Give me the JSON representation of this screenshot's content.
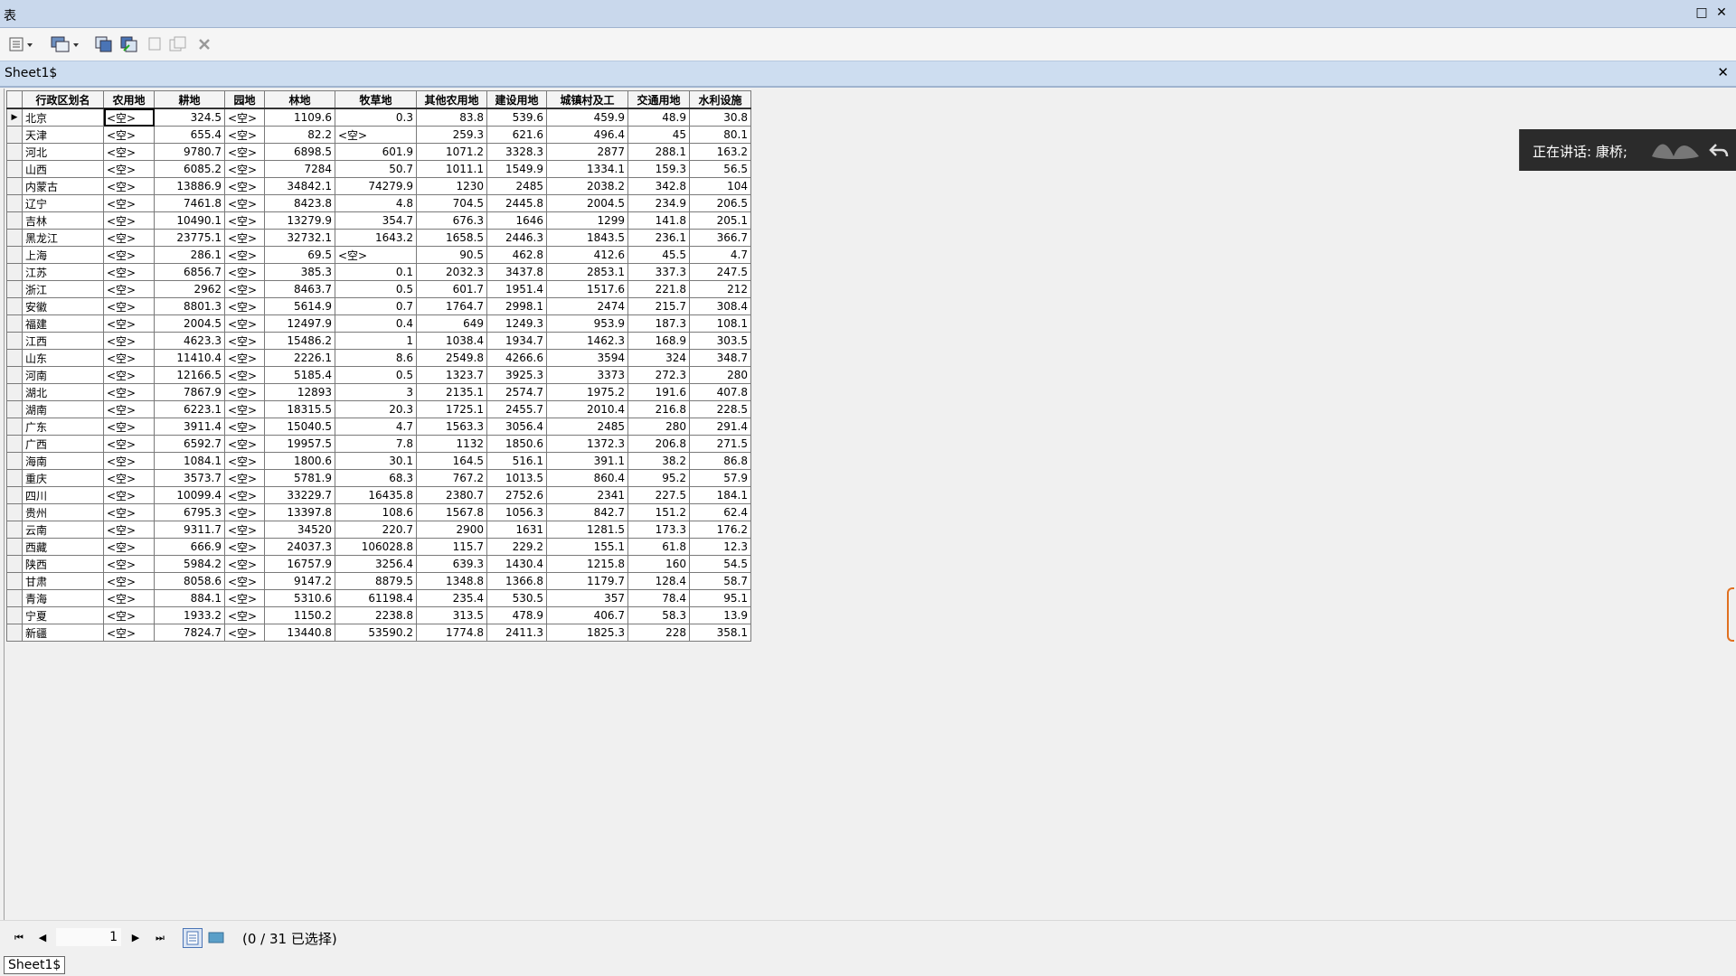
{
  "window": {
    "title": "表"
  },
  "tab": {
    "title": "Sheet1$"
  },
  "table": {
    "headers": [
      "行政区划名",
      "农用地",
      "耕地",
      "园地",
      "林地",
      "牧草地",
      "其他农用地",
      "建设用地",
      "城镇村及工",
      "交通用地",
      "水利设施"
    ],
    "rows": [
      [
        "北京",
        "<空>",
        "324.5",
        "<空>",
        "1109.6",
        "0.3",
        "83.8",
        "539.6",
        "459.9",
        "48.9",
        "30.8"
      ],
      [
        "天津",
        "<空>",
        "655.4",
        "<空>",
        "82.2",
        "<空>",
        "259.3",
        "621.6",
        "496.4",
        "45",
        "80.1"
      ],
      [
        "河北",
        "<空>",
        "9780.7",
        "<空>",
        "6898.5",
        "601.9",
        "1071.2",
        "3328.3",
        "2877",
        "288.1",
        "163.2"
      ],
      [
        "山西",
        "<空>",
        "6085.2",
        "<空>",
        "7284",
        "50.7",
        "1011.1",
        "1549.9",
        "1334.1",
        "159.3",
        "56.5"
      ],
      [
        "内蒙古",
        "<空>",
        "13886.9",
        "<空>",
        "34842.1",
        "74279.9",
        "1230",
        "2485",
        "2038.2",
        "342.8",
        "104"
      ],
      [
        "辽宁",
        "<空>",
        "7461.8",
        "<空>",
        "8423.8",
        "4.8",
        "704.5",
        "2445.8",
        "2004.5",
        "234.9",
        "206.5"
      ],
      [
        "吉林",
        "<空>",
        "10490.1",
        "<空>",
        "13279.9",
        "354.7",
        "676.3",
        "1646",
        "1299",
        "141.8",
        "205.1"
      ],
      [
        "黑龙江",
        "<空>",
        "23775.1",
        "<空>",
        "32732.1",
        "1643.2",
        "1658.5",
        "2446.3",
        "1843.5",
        "236.1",
        "366.7"
      ],
      [
        "上海",
        "<空>",
        "286.1",
        "<空>",
        "69.5",
        "<空>",
        "90.5",
        "462.8",
        "412.6",
        "45.5",
        "4.7"
      ],
      [
        "江苏",
        "<空>",
        "6856.7",
        "<空>",
        "385.3",
        "0.1",
        "2032.3",
        "3437.8",
        "2853.1",
        "337.3",
        "247.5"
      ],
      [
        "浙江",
        "<空>",
        "2962",
        "<空>",
        "8463.7",
        "0.5",
        "601.7",
        "1951.4",
        "1517.6",
        "221.8",
        "212"
      ],
      [
        "安徽",
        "<空>",
        "8801.3",
        "<空>",
        "5614.9",
        "0.7",
        "1764.7",
        "2998.1",
        "2474",
        "215.7",
        "308.4"
      ],
      [
        "福建",
        "<空>",
        "2004.5",
        "<空>",
        "12497.9",
        "0.4",
        "649",
        "1249.3",
        "953.9",
        "187.3",
        "108.1"
      ],
      [
        "江西",
        "<空>",
        "4623.3",
        "<空>",
        "15486.2",
        "1",
        "1038.4",
        "1934.7",
        "1462.3",
        "168.9",
        "303.5"
      ],
      [
        "山东",
        "<空>",
        "11410.4",
        "<空>",
        "2226.1",
        "8.6",
        "2549.8",
        "4266.6",
        "3594",
        "324",
        "348.7"
      ],
      [
        "河南",
        "<空>",
        "12166.5",
        "<空>",
        "5185.4",
        "0.5",
        "1323.7",
        "3925.3",
        "3373",
        "272.3",
        "280"
      ],
      [
        "湖北",
        "<空>",
        "7867.9",
        "<空>",
        "12893",
        "3",
        "2135.1",
        "2574.7",
        "1975.2",
        "191.6",
        "407.8"
      ],
      [
        "湖南",
        "<空>",
        "6223.1",
        "<空>",
        "18315.5",
        "20.3",
        "1725.1",
        "2455.7",
        "2010.4",
        "216.8",
        "228.5"
      ],
      [
        "广东",
        "<空>",
        "3911.4",
        "<空>",
        "15040.5",
        "4.7",
        "1563.3",
        "3056.4",
        "2485",
        "280",
        "291.4"
      ],
      [
        "广西",
        "<空>",
        "6592.7",
        "<空>",
        "19957.5",
        "7.8",
        "1132",
        "1850.6",
        "1372.3",
        "206.8",
        "271.5"
      ],
      [
        "海南",
        "<空>",
        "1084.1",
        "<空>",
        "1800.6",
        "30.1",
        "164.5",
        "516.1",
        "391.1",
        "38.2",
        "86.8"
      ],
      [
        "重庆",
        "<空>",
        "3573.7",
        "<空>",
        "5781.9",
        "68.3",
        "767.2",
        "1013.5",
        "860.4",
        "95.2",
        "57.9"
      ],
      [
        "四川",
        "<空>",
        "10099.4",
        "<空>",
        "33229.7",
        "16435.8",
        "2380.7",
        "2752.6",
        "2341",
        "227.5",
        "184.1"
      ],
      [
        "贵州",
        "<空>",
        "6795.3",
        "<空>",
        "13397.8",
        "108.6",
        "1567.8",
        "1056.3",
        "842.7",
        "151.2",
        "62.4"
      ],
      [
        "云南",
        "<空>",
        "9311.7",
        "<空>",
        "34520",
        "220.7",
        "2900",
        "1631",
        "1281.5",
        "173.3",
        "176.2"
      ],
      [
        "西藏",
        "<空>",
        "666.9",
        "<空>",
        "24037.3",
        "106028.8",
        "115.7",
        "229.2",
        "155.1",
        "61.8",
        "12.3"
      ],
      [
        "陕西",
        "<空>",
        "5984.2",
        "<空>",
        "16757.9",
        "3256.4",
        "639.3",
        "1430.4",
        "1215.8",
        "160",
        "54.5"
      ],
      [
        "甘肃",
        "<空>",
        "8058.6",
        "<空>",
        "9147.2",
        "8879.5",
        "1348.8",
        "1366.8",
        "1179.7",
        "128.4",
        "58.7"
      ],
      [
        "青海",
        "<空>",
        "884.1",
        "<空>",
        "5310.6",
        "61198.4",
        "235.4",
        "530.5",
        "357",
        "78.4",
        "95.1"
      ],
      [
        "宁夏",
        "<空>",
        "1933.2",
        "<空>",
        "1150.2",
        "2238.8",
        "313.5",
        "478.9",
        "406.7",
        "58.3",
        "13.9"
      ],
      [
        "新疆",
        "<空>",
        "7824.7",
        "<空>",
        "13440.8",
        "53590.2",
        "1774.8",
        "2411.3",
        "1825.3",
        "228",
        "358.1"
      ]
    ]
  },
  "status": {
    "page": "1",
    "selection": "(0 / 31 已选择)"
  },
  "bottom_tab": {
    "label": "Sheet1$"
  },
  "speaking": {
    "text": "正在讲话: 康桥;"
  }
}
